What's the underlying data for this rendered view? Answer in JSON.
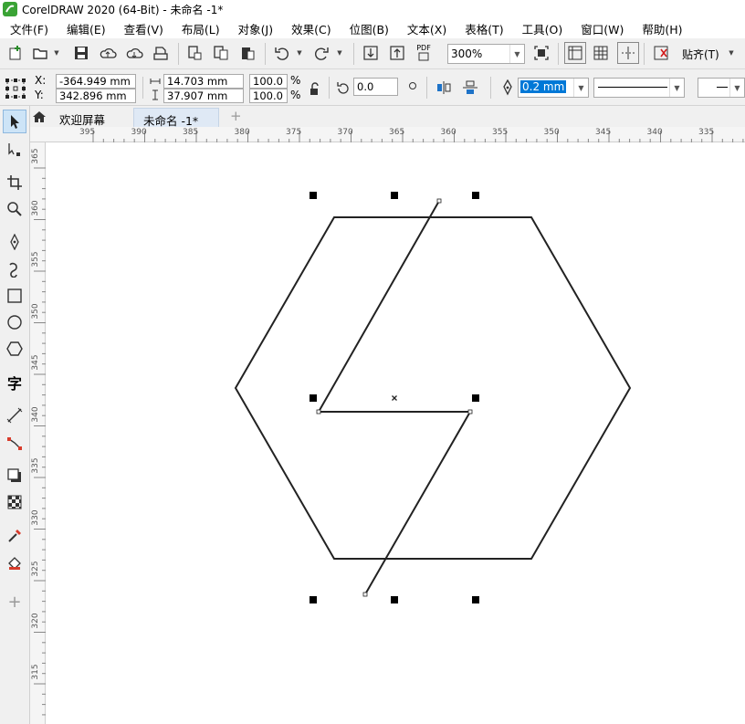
{
  "window": {
    "title": "CorelDRAW 2020 (64-Bit) - 未命名 -1*"
  },
  "menu": [
    "文件(F)",
    "编辑(E)",
    "查看(V)",
    "布局(L)",
    "对象(J)",
    "效果(C)",
    "位图(B)",
    "文本(X)",
    "表格(T)",
    "工具(O)",
    "窗口(W)",
    "帮助(H)"
  ],
  "toolbar": {
    "zoom_value": "300%",
    "snap_label": "贴齐(T)",
    "pdf_label": "PDF"
  },
  "properties": {
    "x_label": "X:",
    "y_label": "Y:",
    "x_value": "-364.949 mm",
    "y_value": "342.896 mm",
    "width_value": "14.703 mm",
    "height_value": "37.907 mm",
    "scale_w": "100.0",
    "scale_h": "100.0",
    "percent_symbol": "%",
    "rotation": "0.0",
    "outline_width": "0.2 mm"
  },
  "tabs": {
    "welcome": "欢迎屏幕",
    "document": "未命名 -1*",
    "add": "+"
  },
  "rulers": {
    "horizontal_ticks": [
      "395",
      "390",
      "385",
      "380",
      "375",
      "370",
      "365",
      "360",
      "355",
      "350",
      "345",
      "340",
      "335"
    ],
    "vertical_ticks": [
      "365",
      "360",
      "355",
      "350",
      "345",
      "340",
      "335",
      "330",
      "325",
      "320",
      "315"
    ]
  },
  "colors": {
    "accent": "#1e73c8",
    "selection_highlight": "#0078d7",
    "active_tab": "#dfe9f5",
    "logo_green": "#3aa335"
  }
}
